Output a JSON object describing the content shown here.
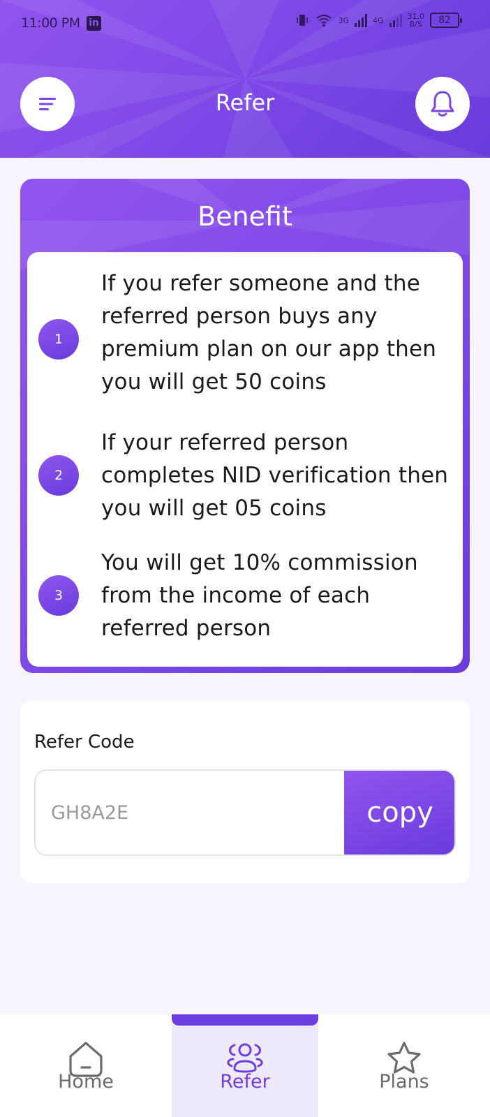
{
  "status_bar": {
    "time": "11:00 PM",
    "app_badge": "in",
    "network_3g": "3G",
    "network_4g": "4G",
    "speed_value": "31.0",
    "speed_unit": "B/S",
    "battery": "82"
  },
  "header": {
    "title": "Refer",
    "menu_icon": "menu-icon",
    "bell_icon": "bell-icon"
  },
  "benefit": {
    "title": "Benefit",
    "items": [
      {
        "number": "1",
        "text": "If you refer someone and the referred person buys any premium plan on our app then you will get 50 coins"
      },
      {
        "number": "2",
        "text": "If your referred person completes NID verification then you will get 05 coins"
      },
      {
        "number": "3",
        "text": "You will get 10% commission from the income of each referred person"
      }
    ]
  },
  "refer_code": {
    "label": "Refer Code",
    "value": "GH8A2E",
    "copy_label": "copy"
  },
  "bottom_nav": {
    "items": [
      {
        "label": "Home",
        "icon": "home-icon"
      },
      {
        "label": "Refer",
        "icon": "users-icon",
        "active": true
      },
      {
        "label": "Plans",
        "icon": "star-icon"
      }
    ]
  },
  "colors": {
    "primary": "#7b46e6",
    "primary_dark": "#6a3bdc",
    "background": "#f7f4fd",
    "active_nav_bg": "#efeafb"
  }
}
